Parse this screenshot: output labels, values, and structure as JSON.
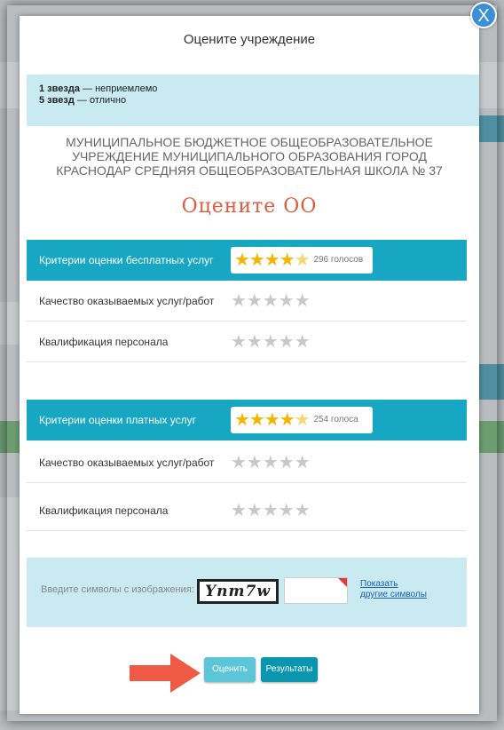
{
  "modal": {
    "title": "Оцените учреждение",
    "close_label": "X"
  },
  "legend": {
    "line1_bold": "1 звезда",
    "line1_rest": " — неприемлемо",
    "line2_bold": "5 звезд",
    "line2_rest": " — отлично"
  },
  "organization": {
    "name": "МУНИЦИПАЛЬНОЕ БЮДЖЕТНОЕ ОБЩЕОБРАЗОВАТЕЛЬНОЕ УЧРЕЖДЕНИЕ МУНИЦИПАЛЬНОГО ОБРАЗОВАНИЯ ГОРОД КРАСНОДАР СРЕДНЯЯ ОБЩЕОБРАЗОВАТЕЛЬНАЯ ШКОЛА № 37"
  },
  "rate_heading": "Оцените ОО",
  "free_services": {
    "header": "Критерии оценки бесплатных услуг",
    "rating": 4.5,
    "votes": "296 голосов",
    "criteria": [
      {
        "label": "Качество оказываемых услуг/работ"
      },
      {
        "label": "Квалификация персонала"
      }
    ]
  },
  "paid_services": {
    "header": "Критерии оценки платных услуг",
    "rating": 4.5,
    "votes": "254 голоса",
    "criteria": [
      {
        "label": "Качество оказываемых услуг/работ"
      },
      {
        "label": "Квалификация персонала"
      }
    ]
  },
  "captcha": {
    "label": "Введите символы с изображения:",
    "image_text": "Ynm7w",
    "input_value": "",
    "link_line1": "Показать",
    "link_line2": "другие символы"
  },
  "buttons": {
    "rate": "Оценить",
    "results": "Результаты"
  },
  "colors": {
    "accent": "#17a7c3",
    "star_active": "#f5b400",
    "star_inactive": "#c8c8c8",
    "heading_red": "#e05a3c",
    "arrow": "#ee5a45"
  }
}
